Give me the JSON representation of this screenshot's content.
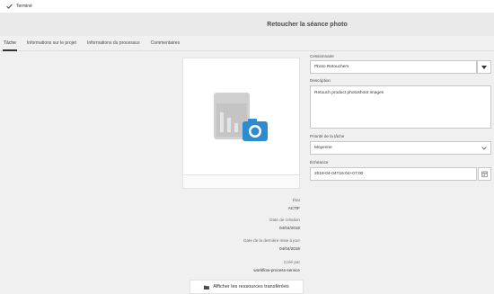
{
  "topbar": {
    "done_label": "Terminé"
  },
  "page": {
    "title": "Retoucher la séance photo"
  },
  "tabs": [
    {
      "label": "Tâche"
    },
    {
      "label": "Informations sur le projet"
    },
    {
      "label": "Informations du processus"
    },
    {
      "label": "Commentaires"
    }
  ],
  "details": {
    "status_label": "État",
    "status_value": "ACTIF",
    "created_label": "Date de création",
    "created_value": "04/04/2018",
    "modified_label": "Date de la dernière mise à jour",
    "modified_value": "04/04/2018",
    "author_label": "Créé par",
    "author_value": "workflow-process-service"
  },
  "transfer_button": {
    "label": "Afficher les ressources transférées"
  },
  "form": {
    "assignee_label": "Cessionnaire",
    "assignee_value": "Photo Retouchers",
    "description_label": "Description",
    "description_value": "Retouch product photoshoot images",
    "priority_label": "Priorité de la tâche",
    "priority_value": "Moyenne",
    "due_label": "Échéance",
    "due_value": "2018-04-04T16:04+07:00"
  },
  "icons": {
    "check": "checkmark-icon",
    "asset": "image-placeholder-icon",
    "folder": "folder-icon",
    "dropdown": "caret-down-icon",
    "calendar": "calendar-icon"
  },
  "colors": {
    "accent": "#2d8ccf",
    "placeholder_gray": "#d0d0d0",
    "title_bar": "#eaeaea"
  }
}
